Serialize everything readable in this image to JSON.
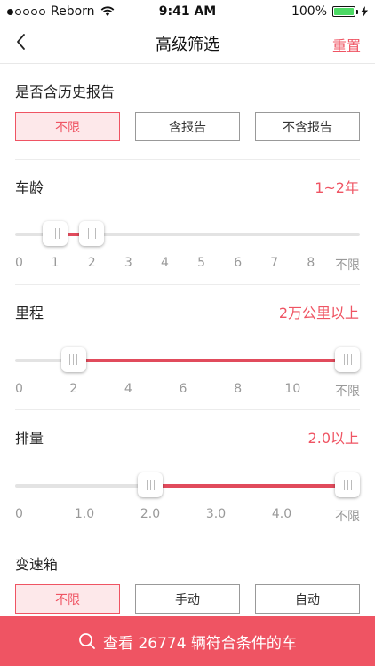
{
  "status_bar": {
    "carrier": "Reborn",
    "time": "9:41 AM",
    "battery": "100%"
  },
  "nav": {
    "title": "高级筛选",
    "reset": "重置"
  },
  "history": {
    "label": "是否含历史报告",
    "options": [
      "不限",
      "含报告",
      "不含报告"
    ],
    "selected": 0
  },
  "age": {
    "label": "车龄",
    "value": "1~2年",
    "ticks": [
      "0",
      "1",
      "2",
      "3",
      "4",
      "5",
      "6",
      "7",
      "8",
      "不限"
    ],
    "range_start_index": 1,
    "range_end_index": 2
  },
  "mileage": {
    "label": "里程",
    "value": "2万公里以上",
    "ticks": [
      "0",
      "2",
      "4",
      "6",
      "8",
      "10",
      "不限"
    ],
    "range_start_index": 1,
    "range_end_index": 6
  },
  "displacement": {
    "label": "排量",
    "value": "2.0以上",
    "ticks": [
      "0",
      "1.0",
      "2.0",
      "3.0",
      "4.0",
      "不限"
    ],
    "range_start_index": 2,
    "range_end_index": 5
  },
  "transmission": {
    "label": "变速箱",
    "options": [
      "不限",
      "手动",
      "自动"
    ],
    "selected": 0
  },
  "bottom": {
    "label": "查看 26774 辆符合条件的车"
  },
  "colors": {
    "accent": "#ef5463",
    "accent_bg": "#fde8ea",
    "range": "#e14b5c"
  }
}
